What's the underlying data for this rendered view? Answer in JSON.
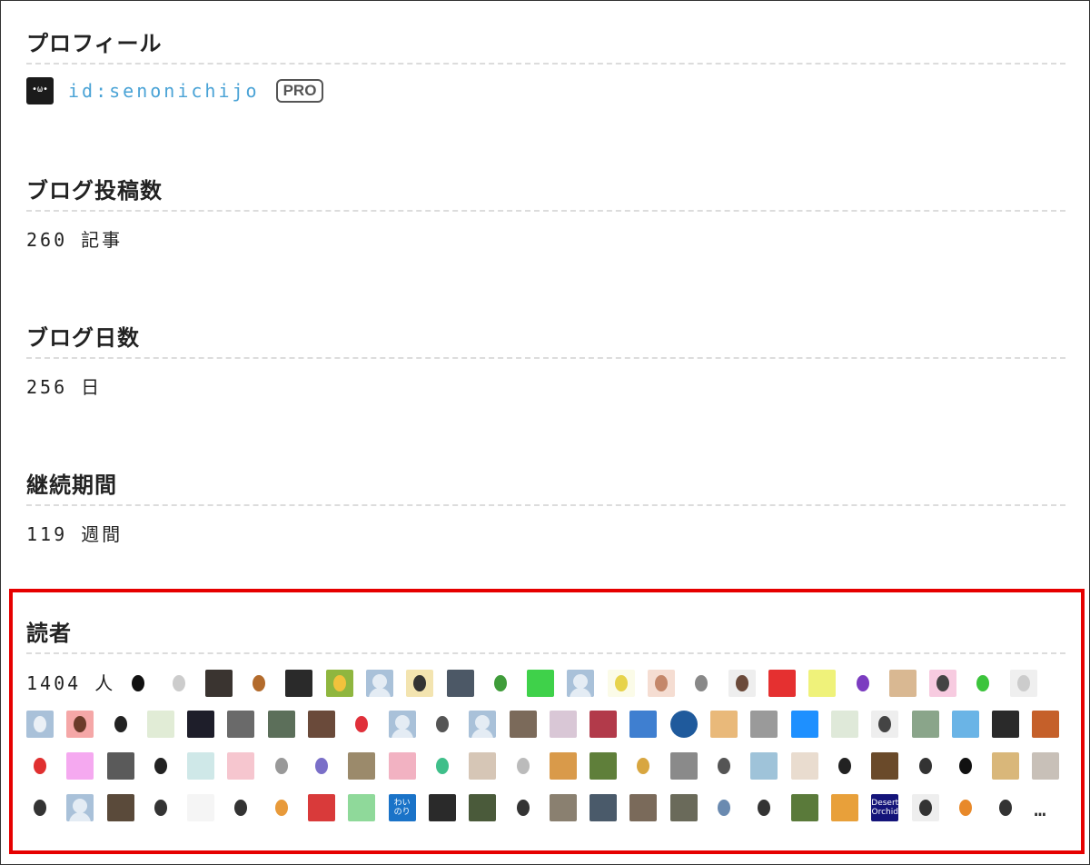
{
  "profile": {
    "heading": "プロフィール",
    "user_id": "id:senonichijo",
    "badge": "PRO",
    "avatar_icon": "black-cat-face-icon"
  },
  "posts": {
    "heading": "ブログ投稿数",
    "value": "260 記事"
  },
  "days": {
    "heading": "ブログ日数",
    "value": "256 日"
  },
  "period": {
    "heading": "継続期間",
    "value": "119 週間"
  },
  "readers": {
    "heading": "読者",
    "count": "1404 人",
    "more": "…",
    "highlight_color": "#e60000",
    "link_color": "#4aa3d6",
    "rows": [
      [
        {
          "c": "#ffffff",
          "icon": "darth-helmet-icon",
          "inner": "#111111"
        },
        {
          "c": "#ffffff",
          "icon": "bird-sketch-icon",
          "inner": "#cccccc"
        },
        {
          "c": "#3a3430",
          "icon": "dark-photo-icon"
        },
        {
          "c": "#ffffff",
          "icon": "boy-cartoon-icon",
          "inner": "#b36b2c",
          "round": true
        },
        {
          "c": "#2a2a2a",
          "icon": "night-photo-icon"
        },
        {
          "c": "#8fb63f",
          "icon": "mustache-icon",
          "inner": "#f2c23c"
        },
        {
          "c": "#a9c1d9",
          "icon": "default-user-icon",
          "placeholder": true
        },
        {
          "c": "#f3e4b0",
          "icon": "character-icon",
          "inner": "#333333"
        },
        {
          "c": "#4c5866",
          "icon": "room-photo-icon"
        },
        {
          "c": "#ffffff",
          "icon": "green-character-icon",
          "inner": "#3f9c3a",
          "round": true
        },
        {
          "c": "#3fd14a",
          "icon": "green-field-icon"
        },
        {
          "c": "#a9c1d9",
          "icon": "default-user-icon",
          "placeholder": true
        },
        {
          "c": "#fbfbe8",
          "icon": "dandelion-icon",
          "inner": "#e7d34b"
        },
        {
          "c": "#f5ddd2",
          "icon": "girl-illustration-icon",
          "inner": "#c4876a"
        },
        {
          "c": "#ffffff",
          "icon": "hand-sketch-icon",
          "inner": "#888888"
        },
        {
          "c": "#eeeeee",
          "icon": "woman-avatar-icon",
          "inner": "#6b4a3a"
        },
        {
          "c": "#e53030",
          "icon": "red-figure-icon"
        },
        {
          "c": "#eff27a",
          "icon": "yellow-pattern-icon"
        },
        {
          "c": "#ffffff",
          "icon": "purple-devil-icon",
          "inner": "#7b3cc0",
          "round": true
        },
        {
          "c": "#d9b892",
          "icon": "dog-photo-icon"
        },
        {
          "c": "#f7cbe0",
          "icon": "glasses-girl-icon",
          "inner": "#444444"
        },
        {
          "c": "#ffffff",
          "icon": "green-puyo-icon",
          "inner": "#3cc43c",
          "round": true
        },
        {
          "c": "#efefef",
          "icon": "polar-bear-icon",
          "inner": "#cccccc"
        }
      ],
      [
        {
          "c": "#a9c1d9",
          "icon": "robot-face-icon",
          "inner": "#eaf0f6"
        },
        {
          "c": "#f5a7a7",
          "icon": "girl-face-icon",
          "inner": "#6b3b2a"
        },
        {
          "c": "#ffffff",
          "icon": "white-bear-circle-icon",
          "inner": "#222222",
          "round": true
        },
        {
          "c": "#e1ecd6",
          "icon": "map-icon"
        },
        {
          "c": "#1e1e2a",
          "icon": "figure-photo-icon"
        },
        {
          "c": "#6a6a6a",
          "icon": "black-white-photo-icon"
        },
        {
          "c": "#5c6f5a",
          "icon": "waterfall-photo-icon"
        },
        {
          "c": "#6a4a3a",
          "icon": "interior-photo-icon"
        },
        {
          "c": "#ffffff",
          "icon": "red-heart-icon",
          "inner": "#e0303a",
          "round": true
        },
        {
          "c": "#a9c1d9",
          "icon": "default-user-icon",
          "placeholder": true
        },
        {
          "c": "#ffffff",
          "icon": "sunglasses-man-icon",
          "inner": "#555555",
          "round": true
        },
        {
          "c": "#a9c1d9",
          "icon": "default-user-icon",
          "placeholder": true
        },
        {
          "c": "#7b6a5a",
          "icon": "cat-photo-icon"
        },
        {
          "c": "#d9c7d6",
          "icon": "anime-girl-icon"
        },
        {
          "c": "#b23a4a",
          "icon": "colorful-pattern-icon"
        },
        {
          "c": "#3f7fd0",
          "icon": "man-avatar-icon"
        },
        {
          "c": "#1f5a9c",
          "icon": "paper-plane-icon",
          "round": true
        },
        {
          "c": "#e9b97a",
          "icon": "woman-photo-icon"
        },
        {
          "c": "#9a9a9a",
          "icon": "gray-portrait-icon"
        },
        {
          "c": "#1e90ff",
          "icon": "red-hood-icon"
        },
        {
          "c": "#dfe9d9",
          "icon": "ghost-character-icon"
        },
        {
          "c": "#eeeeee",
          "icon": "glasses-man-icon",
          "inner": "#444444"
        },
        {
          "c": "#8aa58a",
          "icon": "plant-photo-icon"
        },
        {
          "c": "#6ab4e6",
          "icon": "red-figure-blue-icon"
        },
        {
          "c": "#2a2a2a",
          "icon": "dark-tree-icon"
        },
        {
          "c": "#c5602a",
          "icon": "sunset-icon"
        }
      ],
      [
        {
          "c": "#ffffff",
          "icon": "chicken-icon",
          "inner": "#e03030"
        },
        {
          "c": "#f5a9f0",
          "icon": "pink-pattern-icon"
        },
        {
          "c": "#5a5a5a",
          "icon": "cliff-photo-icon"
        },
        {
          "c": "#ffffff",
          "icon": "black-circle-logo-icon",
          "inner": "#222222",
          "round": true
        },
        {
          "c": "#cfe8e8",
          "icon": "text-card-icon"
        },
        {
          "c": "#f6c6cf",
          "icon": "pink-hair-girl-icon"
        },
        {
          "c": "#ffffff",
          "icon": "doodle-face-icon",
          "inner": "#999999",
          "round": true
        },
        {
          "c": "#ffffff",
          "icon": "purple-flower-icon",
          "inner": "#7a6fc8"
        },
        {
          "c": "#9b8a6b",
          "icon": "cat-face-photo-icon"
        },
        {
          "c": "#f2b2c2",
          "icon": "roses-icon"
        },
        {
          "c": "#ffffff",
          "icon": "green-hair-girl-icon",
          "inner": "#3fbf8a"
        },
        {
          "c": "#d6c6b6",
          "icon": "reading-photo-icon"
        },
        {
          "c": "#ffffff",
          "icon": "pencil-sketch-icon",
          "inner": "#bbbbbb"
        },
        {
          "c": "#d99a4a",
          "icon": "orange-fabric-icon"
        },
        {
          "c": "#5f7f3a",
          "icon": "landscape-photo-icon"
        },
        {
          "c": "#ffffff",
          "icon": "gold-emblem-icon",
          "inner": "#d8a640",
          "round": true
        },
        {
          "c": "#8a8a8a",
          "icon": "star-sketch-icon"
        },
        {
          "c": "#ffffff",
          "icon": "bearded-man-icon",
          "inner": "#555555"
        },
        {
          "c": "#9fc3d9",
          "icon": "woman-blue-icon"
        },
        {
          "c": "#e9dccf",
          "icon": "cat-doll-icon"
        },
        {
          "c": "#ffffff",
          "icon": "black-cat-icon",
          "inner": "#222222"
        },
        {
          "c": "#6a4a2a",
          "icon": "cat-sunglasses-icon"
        },
        {
          "c": "#ffffff",
          "icon": "hat-woman-icon",
          "inner": "#333333",
          "round": true
        },
        {
          "c": "#ffffff",
          "icon": "gecko-icon",
          "inner": "#111111"
        },
        {
          "c": "#d9b77a",
          "icon": "desert-photo-icon"
        },
        {
          "c": "#c8c0b8",
          "icon": "kitten-photo-icon"
        }
      ],
      [
        {
          "c": "#ffffff",
          "icon": "long-hair-woman-icon",
          "inner": "#333333"
        },
        {
          "c": "#a9c1d9",
          "icon": "default-user-icon",
          "placeholder": true
        },
        {
          "c": "#5a4a3a",
          "icon": "coffee-photo-icon"
        },
        {
          "c": "#ffffff",
          "icon": "wand-icon",
          "inner": "#333333"
        },
        {
          "c": "#f5f5f5",
          "icon": "japanese-text-logo-icon"
        },
        {
          "c": "#ffffff",
          "icon": "lightbulb-icon",
          "inner": "#333333"
        },
        {
          "c": "#ffffff",
          "icon": "shiba-dog-icon",
          "inner": "#e89a3a",
          "round": true
        },
        {
          "c": "#d93a3a",
          "icon": "red-hood-character-icon"
        },
        {
          "c": "#8fd99a",
          "icon": "green-monster-icon"
        },
        {
          "c": "#1a73c8",
          "icon": "wainori-logo-icon",
          "text": "わい\nのり"
        },
        {
          "c": "#2a2a2a",
          "icon": "dark-forest-icon"
        },
        {
          "c": "#4a5a3a",
          "icon": "window-photo-icon"
        },
        {
          "c": "#ffffff",
          "icon": "anime-woman-icon",
          "inner": "#333333"
        },
        {
          "c": "#8a8070",
          "icon": "tabby-cat-icon"
        },
        {
          "c": "#4a5a6a",
          "icon": "city-photo-icon"
        },
        {
          "c": "#7a6a5a",
          "icon": "cat-closeup-icon"
        },
        {
          "c": "#6a6a5a",
          "icon": "vintage-photo-icon"
        },
        {
          "c": "#ffffff",
          "icon": "fairy-sketch-icon",
          "inner": "#6a8ab0"
        },
        {
          "c": "#ffffff",
          "icon": "calligraphy-icon",
          "inner": "#333333"
        },
        {
          "c": "#5a7a3a",
          "icon": "garden-photo-icon"
        },
        {
          "c": "#e8a03a",
          "icon": "colorful-sweets-icon"
        },
        {
          "c": "#14147a",
          "icon": "desert-orchid-logo-icon",
          "text": "Desert\nOrchid"
        },
        {
          "c": "#eeeeee",
          "icon": "dark-hair-man-icon",
          "inner": "#333333"
        },
        {
          "c": "#ffffff",
          "icon": "orange-hair-boy-icon",
          "inner": "#e8892a",
          "round": true
        },
        {
          "c": "#ffffff",
          "icon": "suit-man-icon",
          "inner": "#333333"
        }
      ]
    ]
  }
}
